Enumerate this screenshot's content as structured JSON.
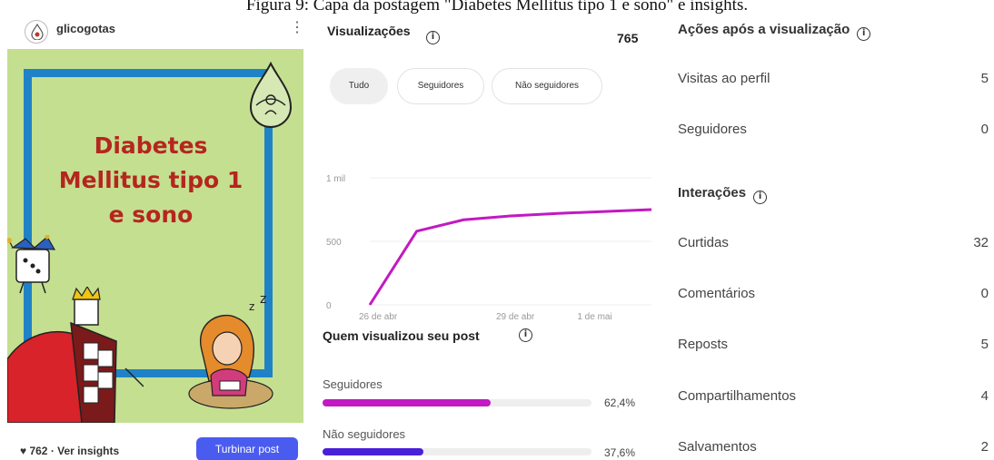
{
  "caption": "Figura 9: Capa da postagem \"Diabetes Mellitus tipo 1 e sono\" e insights.",
  "post": {
    "username": "glicogotas",
    "cover_title_lines": [
      "Diabetes",
      "Mellitus tipo 1",
      "e sono"
    ],
    "logo_text": "glicogotas",
    "stats_text": "♥ 762 · Ver insights",
    "boost_label": "Turbinar post"
  },
  "views": {
    "title": "Visualizações",
    "count": "765",
    "filters": [
      "Tudo",
      "Seguidores",
      "Não seguidores"
    ],
    "active_filter": "Tudo"
  },
  "chart_data": {
    "type": "line",
    "x": [
      "26 de abr",
      "27 de abr",
      "28 de abr",
      "29 de abr",
      "30 de abr",
      "1 de mai",
      "2 de mai"
    ],
    "series": [
      {
        "values": [
          0,
          580,
          670,
          700,
          720,
          735,
          750
        ],
        "color": "#c219c2"
      }
    ],
    "x_tick_labels": [
      "26 de abr",
      "29 de abr",
      "1 de mai"
    ],
    "y_tick_labels": [
      "0",
      "500",
      "1 mil"
    ],
    "ylim": [
      0,
      1000
    ],
    "grid": true
  },
  "who": {
    "title": "Quem visualizou seu post",
    "bars": [
      {
        "label": "Seguidores",
        "pct_text": "62,4%",
        "fraction": 0.624,
        "color": "#c219c2"
      },
      {
        "label": "Não seguidores",
        "pct_text": "37,6%",
        "fraction": 0.376,
        "color": "#4a1fd8"
      }
    ]
  },
  "actions": {
    "title": "Ações após a visualização",
    "rows": [
      {
        "label": "Visitas ao perfil",
        "value": "5"
      },
      {
        "label": "Seguidores",
        "value": "0"
      }
    ]
  },
  "interactions": {
    "title": "Interações",
    "rows": [
      {
        "label": "Curtidas",
        "value": "32"
      },
      {
        "label": "Comentários",
        "value": "0"
      },
      {
        "label": "Reposts",
        "value": "5"
      },
      {
        "label": "Compartilhamentos",
        "value": "4"
      },
      {
        "label": "Salvamentos",
        "value": "2"
      }
    ]
  },
  "icons": {
    "info": "info-icon",
    "more": "more-vertical-icon",
    "heart": "heart-icon"
  }
}
